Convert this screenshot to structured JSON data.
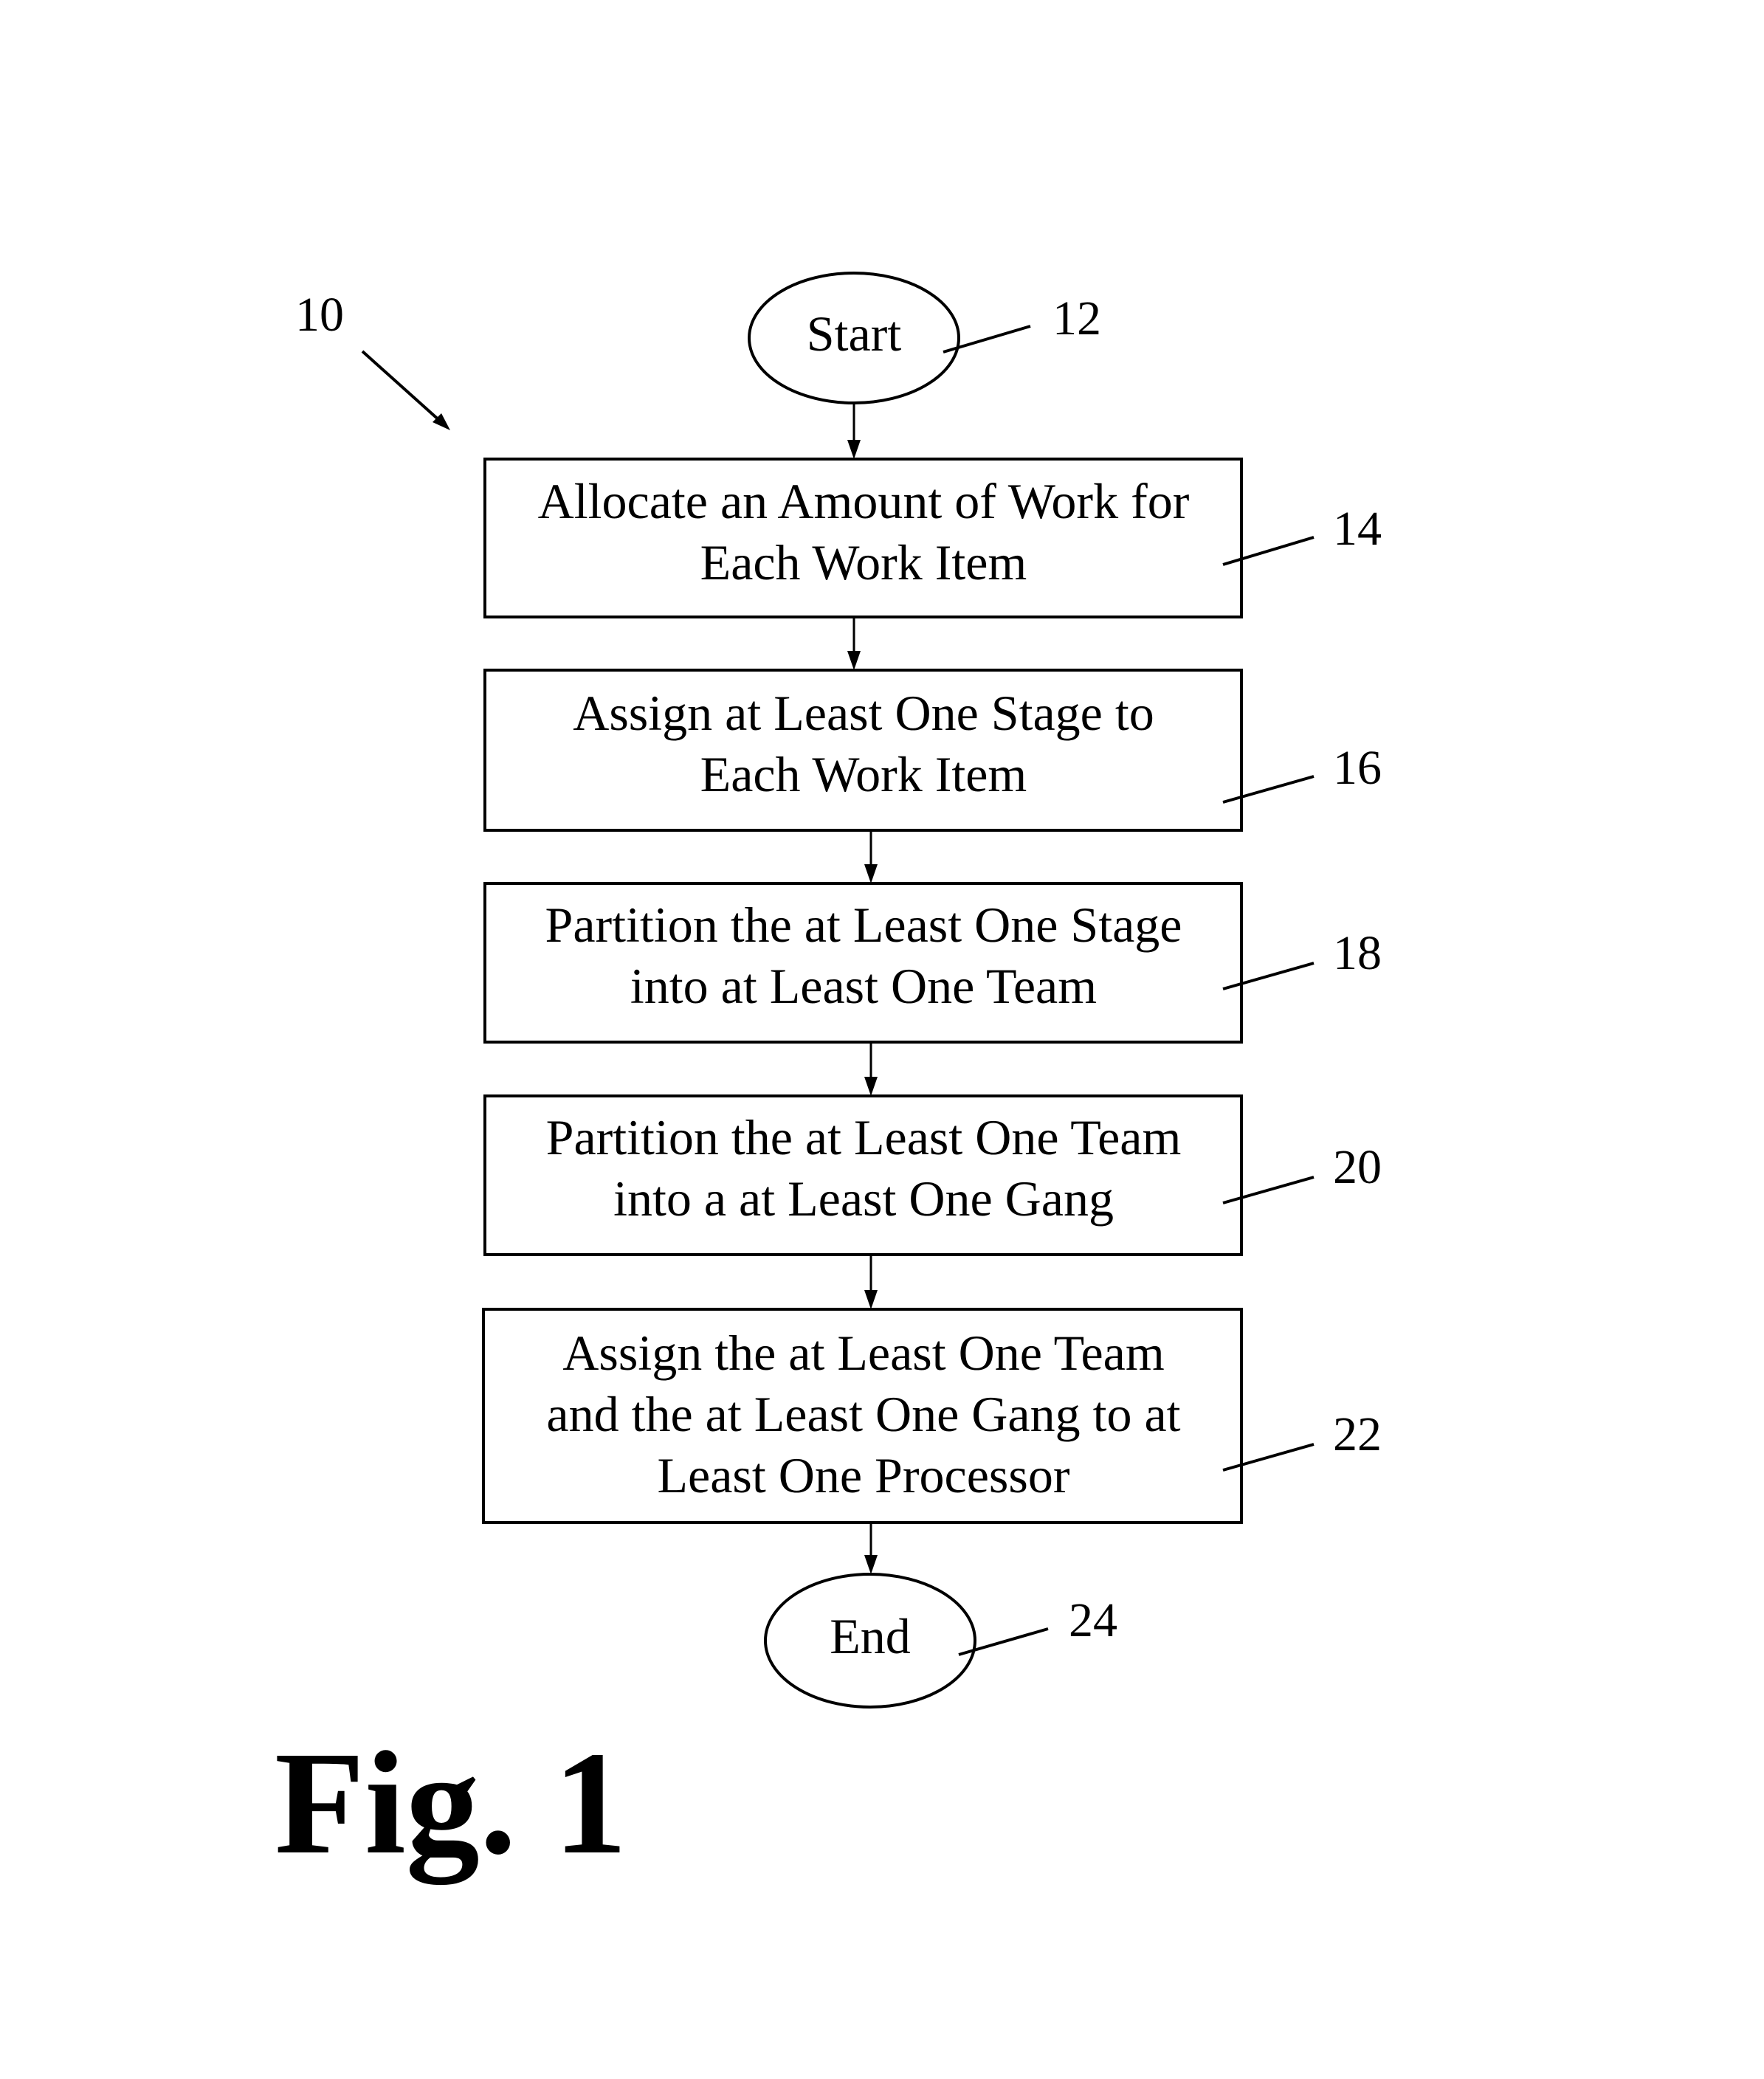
{
  "figure": {
    "title": "Fig. 1",
    "reference": "10"
  },
  "nodes": [
    {
      "id": "start",
      "type": "terminal",
      "lines": [
        "Start"
      ],
      "ref": "12"
    },
    {
      "id": "step14",
      "type": "process",
      "lines": [
        "Allocate an Amount of Work for",
        "Each Work Item"
      ],
      "ref": "14"
    },
    {
      "id": "step16",
      "type": "process",
      "lines": [
        "Assign at Least One Stage to",
        "Each Work Item"
      ],
      "ref": "16"
    },
    {
      "id": "step18",
      "type": "process",
      "lines": [
        "Partition the at Least One Stage",
        "into at Least One Team"
      ],
      "ref": "18"
    },
    {
      "id": "step20",
      "type": "process",
      "lines": [
        "Partition the at Least One Team",
        "into a at Least One Gang"
      ],
      "ref": "20"
    },
    {
      "id": "step22",
      "type": "process",
      "lines": [
        "Assign the at Least One Team",
        "and the at Least One Gang to at",
        "Least One Processor"
      ],
      "ref": "22"
    },
    {
      "id": "end",
      "type": "terminal",
      "lines": [
        "End"
      ],
      "ref": "24"
    }
  ],
  "edges": [
    {
      "from": "start",
      "to": "step14"
    },
    {
      "from": "step14",
      "to": "step16"
    },
    {
      "from": "step16",
      "to": "step18"
    },
    {
      "from": "step18",
      "to": "step20"
    },
    {
      "from": "step20",
      "to": "step22"
    },
    {
      "from": "step22",
      "to": "end"
    }
  ]
}
